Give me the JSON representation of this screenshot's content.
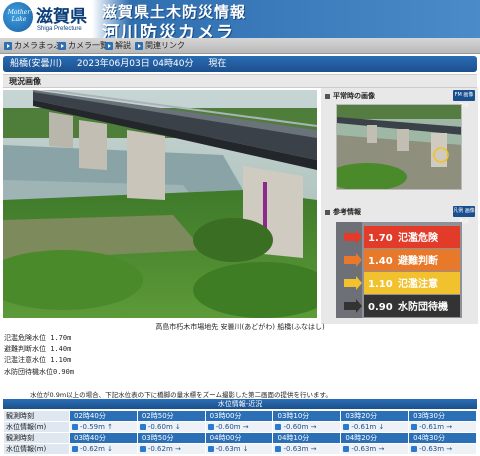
{
  "header": {
    "logo_small": "Mother Lake",
    "logo_name": "滋賀県",
    "logo_sub": "Shiga Prefecture",
    "title_line1": "滋賀県土木防災情報",
    "title_line2": "河川防災カメラ"
  },
  "nav": {
    "items": [
      "カメラまっぷ",
      "カメラ一覧",
      "解説",
      "関連リンク"
    ]
  },
  "station": {
    "name": "船橋(安曇川)",
    "datetime": "2023年06月03日 04時40分",
    "status": "現在"
  },
  "section": {
    "current_image": "現況画像"
  },
  "side": {
    "normal_title": "平常時の画像",
    "normal_badge": "FM 画像表示",
    "ref_title": "参考情報",
    "ref_badge": "凡例 画像表示",
    "ref_levels": [
      {
        "value": "1.70",
        "label": "氾濫危険",
        "color": "#e23b2a"
      },
      {
        "value": "1.40",
        "label": "避難判断",
        "color": "#e8792a"
      },
      {
        "value": "1.10",
        "label": "氾濫注意",
        "color": "#f2c12e"
      },
      {
        "value": "0.90",
        "label": "水防団待機",
        "color": "#333333"
      }
    ]
  },
  "caption": "高島市朽木市場地先 安曇川(あどがわ) 船橋(ふなはし)",
  "levels": [
    "氾濫危険水位 1.70m",
    "避難判断水位 1.40m",
    "氾濫注意水位 1.10m",
    "水防団待機水位0.90m"
  ],
  "note": "水位が0.9m以上の場合、下記水位表の下に橋脚の量水標をズーム撮影した第二画面の提供を行います。",
  "water_table": {
    "title": "水位情報-近況",
    "time_label": "観測時刻",
    "value_label": "水位情報(m)",
    "rows": [
      {
        "times": [
          "02時40分",
          "02時50分",
          "03時00分",
          "03時10分",
          "03時20分",
          "03時30分"
        ],
        "values": [
          "-0.59m ↑",
          "-0.60m ↓",
          "-0.60m →",
          "-0.60m →",
          "-0.61m ↓",
          "-0.61m →"
        ]
      },
      {
        "times": [
          "03時40分",
          "03時50分",
          "04時00分",
          "04時10分",
          "04時20分",
          "04時30分"
        ],
        "values": [
          "-0.62m ↓",
          "-0.62m →",
          "-0.63m ↓",
          "-0.63m →",
          "-0.63m →",
          "-0.63m →"
        ]
      }
    ]
  }
}
